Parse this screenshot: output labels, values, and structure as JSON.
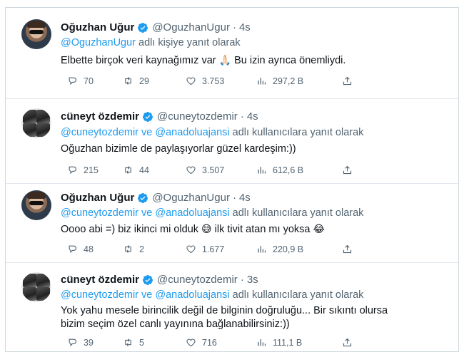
{
  "tweets": [
    {
      "author": "Oğuzhan Uğur",
      "handle": "@OguzhanUgur",
      "time": "4s",
      "reply_mention_1": "@OguzhanUgur",
      "reply_joiner": "",
      "reply_mention_2": "",
      "reply_suffix": " adlı kişiye yanıt olarak",
      "text_1": "Elbette birçok veri kaynağımız var ",
      "emoji_1": "🙏🏻",
      "text_2": " Bu izin ayrıca önemliydi.",
      "emoji_2": "",
      "text_3": "",
      "emoji_3": "",
      "replies": "70",
      "retweets": "29",
      "likes": "3.753",
      "views": "297,2 B"
    },
    {
      "author": "cüneyt özdemir",
      "handle": "@cuneytozdemir",
      "time": "4s",
      "reply_mention_1": "@cuneytozdemir",
      "reply_joiner": " ve ",
      "reply_mention_2": "@anadoluajansi",
      "reply_suffix": " adlı kullanıcılara yanıt olarak",
      "text_1": "Oğuzhan bizimle de paylaşıyorlar güzel kardeşim:))",
      "emoji_1": "",
      "text_2": "",
      "emoji_2": "",
      "text_3": "",
      "emoji_3": "",
      "replies": "215",
      "retweets": "44",
      "likes": "3.507",
      "views": "612,6 B"
    },
    {
      "author": "Oğuzhan Uğur",
      "handle": "@OguzhanUgur",
      "time": "4s",
      "reply_mention_1": "@cuneytozdemir",
      "reply_joiner": " ve ",
      "reply_mention_2": "@anadoluajansi",
      "reply_suffix": " adlı kullanıcılara yanıt olarak",
      "text_1": "Oooo abi =) biz ikinci mi olduk ",
      "emoji_1": "😅",
      "text_2": " ilk tivit atan mı yoksa ",
      "emoji_2": "😂",
      "text_3": "",
      "emoji_3": "",
      "replies": "48",
      "retweets": "2",
      "likes": "1.677",
      "views": "220,9 B"
    },
    {
      "author": "cüneyt özdemir",
      "handle": "@cuneytozdemir",
      "time": "3s",
      "reply_mention_1": "@cuneytozdemir",
      "reply_joiner": " ve ",
      "reply_mention_2": "@anadoluajansi",
      "reply_suffix": " adlı kullanıcılara yanıt olarak",
      "text_1": "Yok yahu mesele birincilik değil de bilginin doğruluğu... Bir sıkıntı olursa bizim seçim özel canlı yayınına bağlanabilirsiniz:))",
      "emoji_1": "",
      "text_2": "",
      "emoji_2": "",
      "text_3": "",
      "emoji_3": "",
      "replies": "39",
      "retweets": "5",
      "likes": "716",
      "views": "111,1 B"
    }
  ],
  "icons": {
    "verified": "verified-badge-icon",
    "reply": "reply-icon",
    "retweet": "retweet-icon",
    "like": "heart-icon",
    "views": "views-icon",
    "share": "share-icon"
  },
  "colors": {
    "accent": "#1d9bf0",
    "secondary_text": "#536471",
    "primary_text": "#0f1419"
  }
}
